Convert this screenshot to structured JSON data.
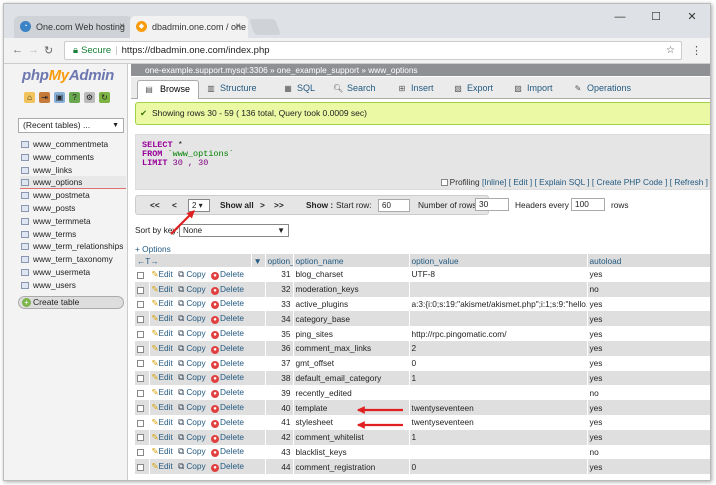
{
  "browser": {
    "tabs": [
      {
        "label": "One.com Web hosting",
        "close": "×"
      },
      {
        "label": "dbadmin.one.com / one",
        "close": "×"
      }
    ],
    "window_controls": [
      "—",
      "☐",
      "✕"
    ],
    "url_secure": "Secure",
    "url": "https://dbadmin.one.com/index.php"
  },
  "sidebar": {
    "logo_php": "php",
    "logo_my": "My",
    "logo_admin": "Admin",
    "recent_label": "(Recent tables) ...",
    "tables": [
      "www_commentmeta",
      "www_comments",
      "www_links",
      "www_options",
      "www_postmeta",
      "www_posts",
      "www_termmeta",
      "www_terms",
      "www_term_relationships",
      "www_term_taxonomy",
      "www_usermeta",
      "www_users"
    ],
    "selected": "www_options",
    "create_table": "Create table"
  },
  "breadcrumb": "one-example.support.mysql:3306 » one_example_support » www_options",
  "tabs": [
    "Browse",
    "Structure",
    "SQL",
    "Search",
    "Insert",
    "Export",
    "Import",
    "Operations"
  ],
  "success": "Showing rows 30 - 59 ( 136 total, Query took 0.0009 sec)",
  "sql": {
    "l1": "SELECT",
    "l1b": " *",
    "l2": "FROM",
    "l2b": " `www_options`",
    "l3": "LIMIT",
    "l3b": " 30 , 30"
  },
  "sql_links": {
    "profiling": "Profiling",
    "inline": "[Inline]",
    "edit": "[ Edit ]",
    "explain": "[ Explain SQL ]",
    "create_php": "[ Create PHP Code ]",
    "refresh": "[ Refresh ]"
  },
  "nav": {
    "first": "<<",
    "prev": "<",
    "page": "2",
    "show_all": "Show all",
    "next": ">",
    "last": ">>",
    "show": "Show :",
    "start_row_label": "Start row:",
    "start_row": "60",
    "num_rows_label": "Number of rows:",
    "num_rows": "30",
    "headers_label": "Headers every",
    "headers": "100",
    "rows": "rows"
  },
  "sort": {
    "label": "Sort by key:",
    "value": "None"
  },
  "options_link": "+ Options",
  "columns": [
    "option_id",
    "option_name",
    "option_value",
    "autoload"
  ],
  "actions": {
    "edit": "Edit",
    "copy": "Copy",
    "delete": "Delete"
  },
  "rows": [
    {
      "id": "31",
      "name": "blog_charset",
      "value": "UTF-8",
      "autoload": "yes"
    },
    {
      "id": "32",
      "name": "moderation_keys",
      "value": "",
      "autoload": "no"
    },
    {
      "id": "33",
      "name": "active_plugins",
      "value": "a:3:{i:0;s:19:\"akismet/akismet.php\";i:1;s:9:\"hello...",
      "autoload": "yes"
    },
    {
      "id": "34",
      "name": "category_base",
      "value": "",
      "autoload": "yes"
    },
    {
      "id": "35",
      "name": "ping_sites",
      "value": "http://rpc.pingomatic.com/",
      "autoload": "yes"
    },
    {
      "id": "36",
      "name": "comment_max_links",
      "value": "2",
      "autoload": "yes"
    },
    {
      "id": "37",
      "name": "gmt_offset",
      "value": "0",
      "autoload": "yes"
    },
    {
      "id": "38",
      "name": "default_email_category",
      "value": "1",
      "autoload": "yes"
    },
    {
      "id": "39",
      "name": "recently_edited",
      "value": "",
      "autoload": "no"
    },
    {
      "id": "40",
      "name": "template",
      "value": "twentyseventeen",
      "autoload": "yes"
    },
    {
      "id": "41",
      "name": "stylesheet",
      "value": "twentyseventeen",
      "autoload": "yes"
    },
    {
      "id": "42",
      "name": "comment_whitelist",
      "value": "1",
      "autoload": "yes"
    },
    {
      "id": "43",
      "name": "blacklist_keys",
      "value": "",
      "autoload": "no"
    },
    {
      "id": "44",
      "name": "comment_registration",
      "value": "0",
      "autoload": "yes"
    }
  ],
  "colors": {
    "accent_link": "#235a81",
    "success_bg": "#ebf8a4",
    "arrow": "#e02020"
  }
}
